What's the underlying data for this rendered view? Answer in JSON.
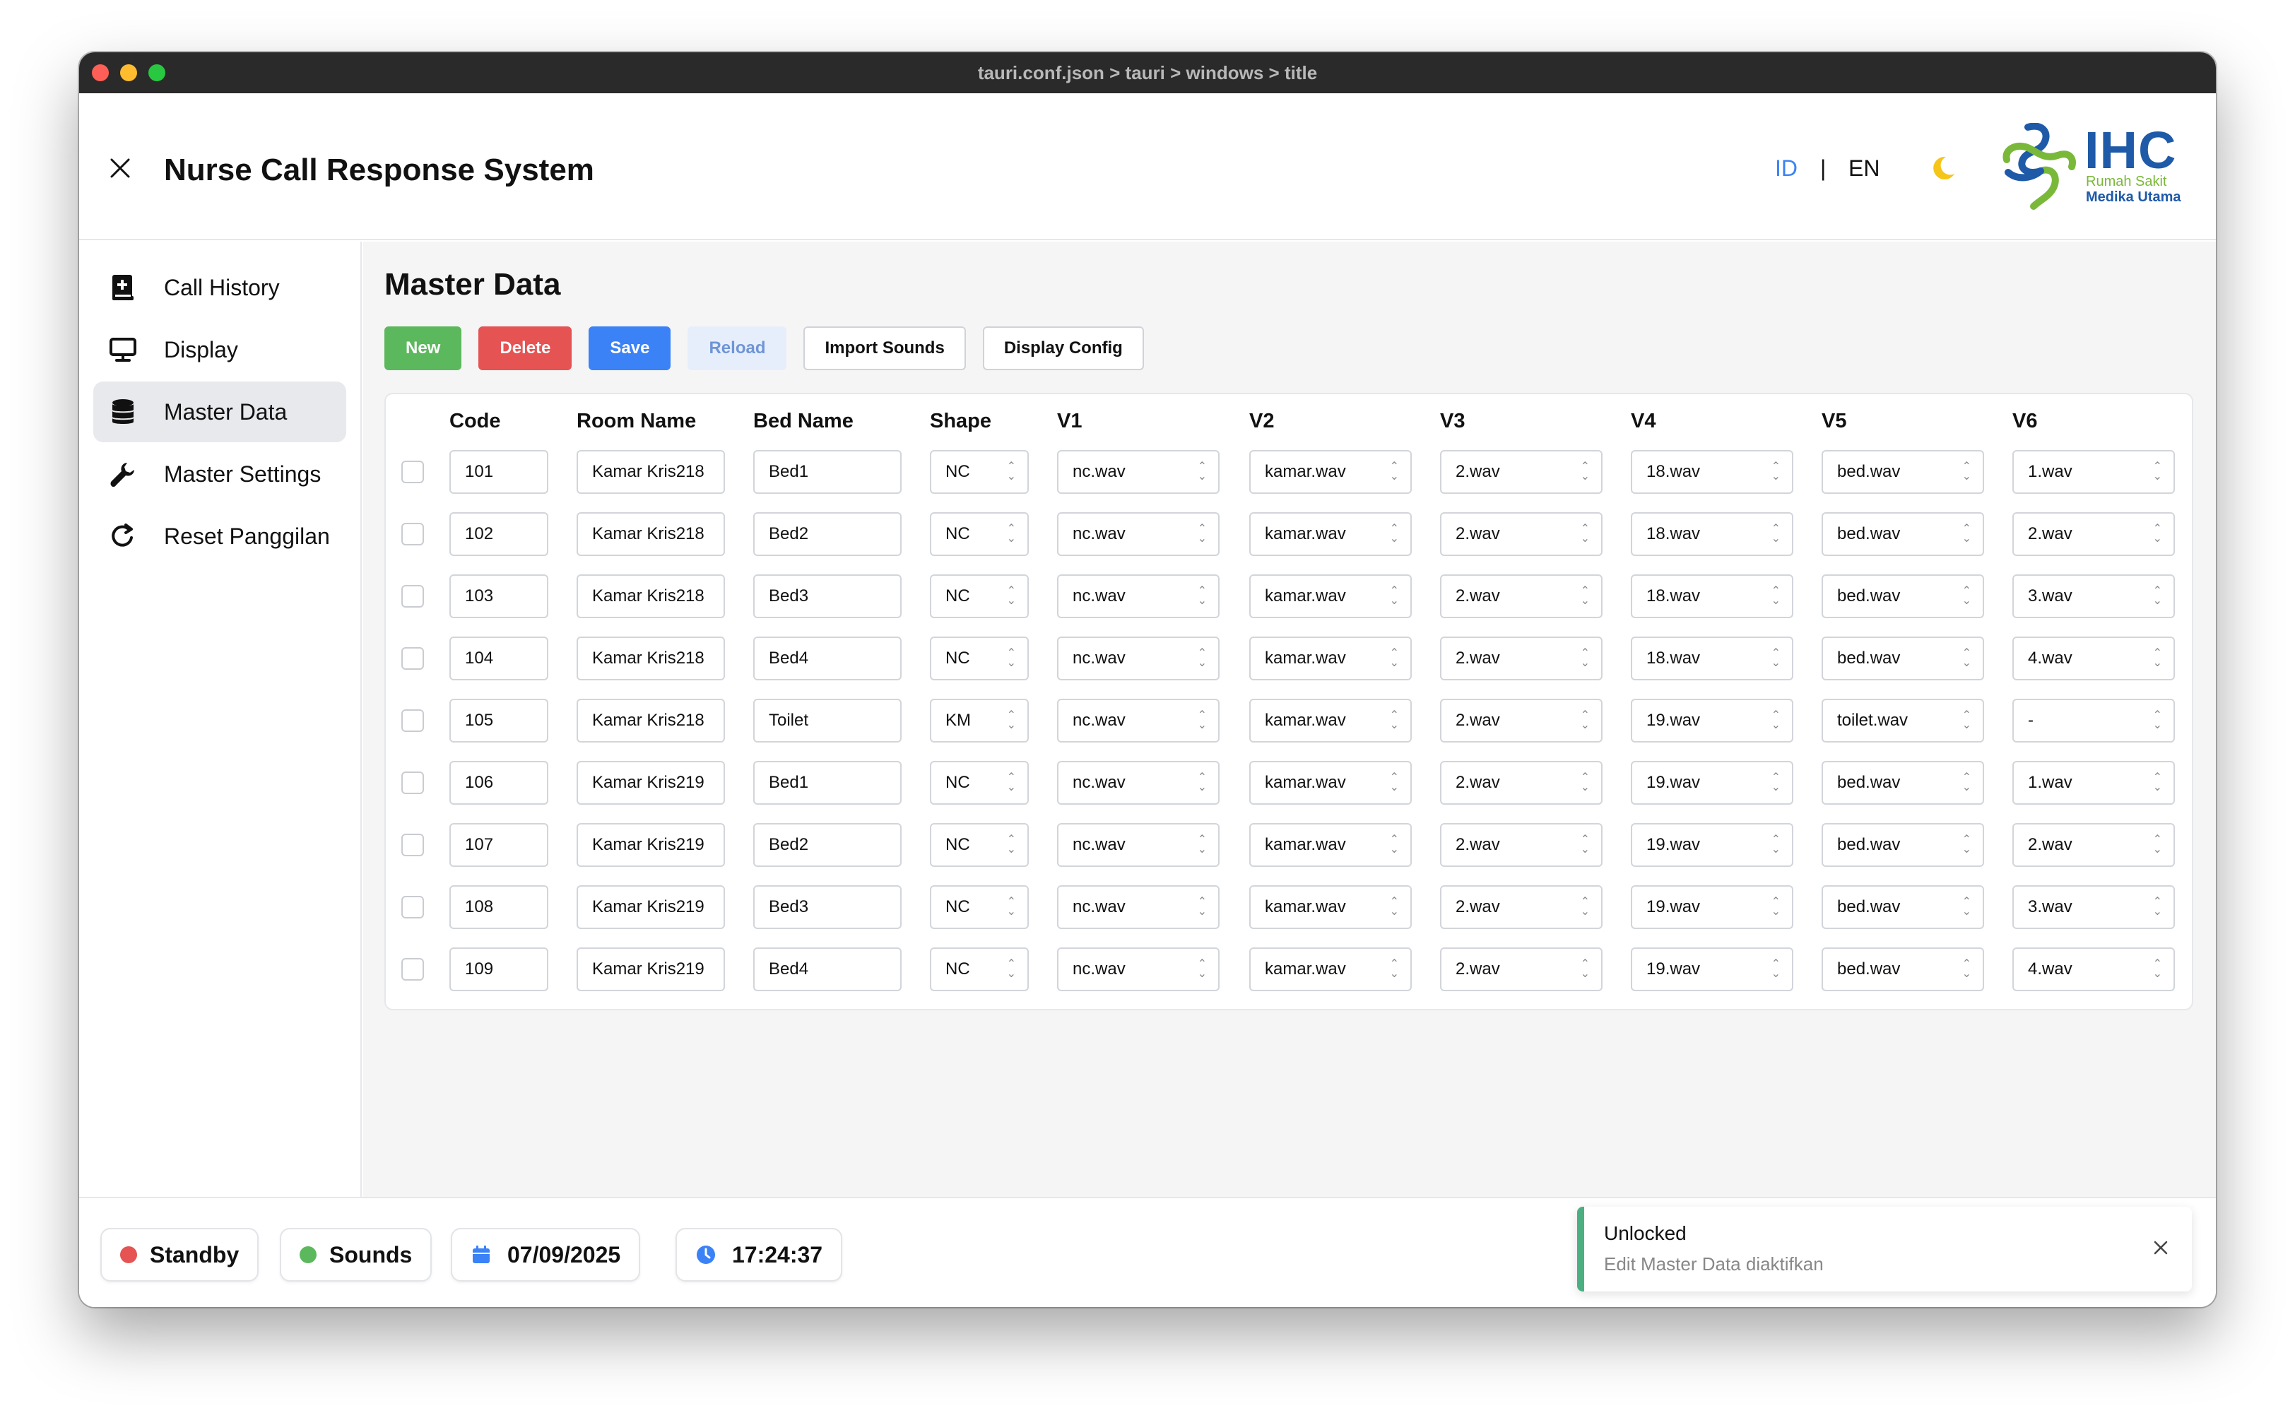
{
  "window": {
    "title": "tauri.conf.json > tauri > windows > title"
  },
  "header": {
    "title": "Nurse Call Response System",
    "lang_id": "ID",
    "lang_sep": "|",
    "lang_en": "EN",
    "logo": {
      "brand": "IHC",
      "line1": "Rumah Sakit",
      "line2": "Medika Utama"
    }
  },
  "sidebar": {
    "items": [
      {
        "label": "Call History",
        "icon": "book-plus-icon"
      },
      {
        "label": "Display",
        "icon": "monitor-icon"
      },
      {
        "label": "Master Data",
        "icon": "database-icon",
        "active": true
      },
      {
        "label": "Master Settings",
        "icon": "wrench-icon"
      },
      {
        "label": "Reset Panggilan",
        "icon": "refresh-icon"
      }
    ]
  },
  "main": {
    "title": "Master Data",
    "toolbar": {
      "new": "New",
      "delete": "Delete",
      "save": "Save",
      "reload": "Reload",
      "import_sounds": "Import Sounds",
      "display_config": "Display Config"
    },
    "columns": [
      "Code",
      "Room Name",
      "Bed Name",
      "Shape",
      "V1",
      "V2",
      "V3",
      "V4",
      "V5",
      "V6"
    ],
    "rows": [
      [
        "101",
        "Kamar Kris218",
        "Bed1",
        "NC",
        "nc.wav",
        "kamar.wav",
        "2.wav",
        "18.wav",
        "bed.wav",
        "1.wav"
      ],
      [
        "102",
        "Kamar Kris218",
        "Bed2",
        "NC",
        "nc.wav",
        "kamar.wav",
        "2.wav",
        "18.wav",
        "bed.wav",
        "2.wav"
      ],
      [
        "103",
        "Kamar Kris218",
        "Bed3",
        "NC",
        "nc.wav",
        "kamar.wav",
        "2.wav",
        "18.wav",
        "bed.wav",
        "3.wav"
      ],
      [
        "104",
        "Kamar Kris218",
        "Bed4",
        "NC",
        "nc.wav",
        "kamar.wav",
        "2.wav",
        "18.wav",
        "bed.wav",
        "4.wav"
      ],
      [
        "105",
        "Kamar Kris218",
        "Toilet",
        "KM",
        "nc.wav",
        "kamar.wav",
        "2.wav",
        "19.wav",
        "toilet.wav",
        "-"
      ],
      [
        "106",
        "Kamar Kris219",
        "Bed1",
        "NC",
        "nc.wav",
        "kamar.wav",
        "2.wav",
        "19.wav",
        "bed.wav",
        "1.wav"
      ],
      [
        "107",
        "Kamar Kris219",
        "Bed2",
        "NC",
        "nc.wav",
        "kamar.wav",
        "2.wav",
        "19.wav",
        "bed.wav",
        "2.wav"
      ],
      [
        "108",
        "Kamar Kris219",
        "Bed3",
        "NC",
        "nc.wav",
        "kamar.wav",
        "2.wav",
        "19.wav",
        "bed.wav",
        "3.wav"
      ],
      [
        "109",
        "Kamar Kris219",
        "Bed4",
        "NC",
        "nc.wav",
        "kamar.wav",
        "2.wav",
        "19.wav",
        "bed.wav",
        "4.wav"
      ]
    ]
  },
  "footer": {
    "standby": "Standby",
    "sounds": "Sounds",
    "date": "07/09/2025",
    "time": "17:24:37"
  },
  "toast": {
    "title": "Unlocked",
    "message": "Edit Master Data diaktifkan"
  },
  "colors": {
    "accent": "#3b82f6",
    "new": "#5cb85c",
    "delete": "#e55353",
    "status_red": "#e55353",
    "status_green": "#5cb85c",
    "toast_bar": "#4caf82"
  }
}
